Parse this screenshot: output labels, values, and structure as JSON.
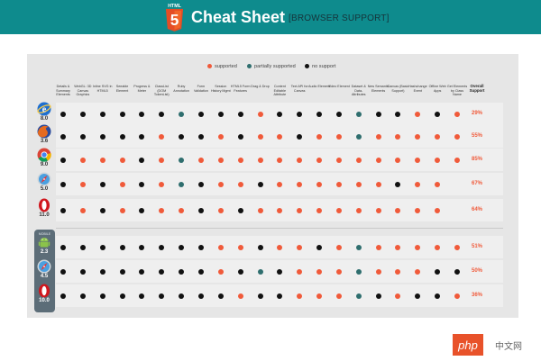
{
  "header": {
    "logo_text": "HTML",
    "logo_number": "5",
    "title": "Cheat Sheet",
    "subtitle": "[BROWSER SUPPORT]"
  },
  "legend": [
    {
      "label": "supported",
      "color": "#f05a3a"
    },
    {
      "label": "partially supported",
      "color": "#2f6e6e"
    },
    {
      "label": "no support",
      "color": "#111111"
    }
  ],
  "columns": [
    "Details & Summary Elements",
    "WebGL: 3D Canvas Graphics",
    "Inline SVG in HTML5",
    "Seeable Element",
    "Progress & Meter",
    "ClassList (DOM TokenList)",
    "Ruby Annotation",
    "Form Validation",
    "Session History Mgmt",
    "HTML5 Form Features",
    "Drag & Drop",
    "Content Editable Attribute",
    "Text API for Canvas",
    "Audio Element",
    "Video Element",
    "Dataset & Data- Attributes",
    "New Semantic Elements",
    "Canvas (Basic Support)",
    "Hashchange Event",
    "Offline Web Apps",
    "Get Elements by Class Name"
  ],
  "overall_label": "Overall Support",
  "mobile_label": "MOBILE",
  "browsers": [
    {
      "name": "Internet Explorer",
      "icon": "ie-icon",
      "version": "8.0",
      "overall": "29%",
      "support": "nnnnnnpnnnsnnnnpnnsns",
      "group": "desktop"
    },
    {
      "name": "Firefox",
      "icon": "firefox-icon",
      "version": "3.6",
      "overall": "55%",
      "support": "nnnnnsnnsnssnsspsssss",
      "group": "desktop"
    },
    {
      "name": "Chrome",
      "icon": "chrome-icon",
      "version": "9.0",
      "overall": "85%",
      "support": "nsssnspsssssssssssssss",
      "group": "desktop"
    },
    {
      "name": "Safari",
      "icon": "safari-icon",
      "version": "5.0",
      "overall": "67%",
      "support": "nsnsnspnssnssssssnss",
      "group": "desktop"
    },
    {
      "name": "Opera",
      "icon": "opera-icon",
      "version": "11.0",
      "overall": "64%",
      "support": "nsnsnssnsnssssssssss",
      "group": "desktop"
    },
    {
      "name": "Android",
      "icon": "android-icon",
      "version": "2.3",
      "overall": "51%",
      "support": "nnnnnnnnssnssnspsssss",
      "group": "mobile"
    },
    {
      "name": "Safari Mobile",
      "icon": "safari-mobile-icon",
      "version": "4.5",
      "overall": "50%",
      "support": "nnnnnnnnsnpnssspsssnn",
      "group": "mobile"
    },
    {
      "name": "Opera Mobile",
      "icon": "opera-mobile-icon",
      "version": "10.0",
      "overall": "36%",
      "support": "nnnnnnnnnsnnssspnsnns",
      "group": "mobile"
    }
  ],
  "watermark": {
    "text_a": "php",
    "text_b": "中文网"
  }
}
